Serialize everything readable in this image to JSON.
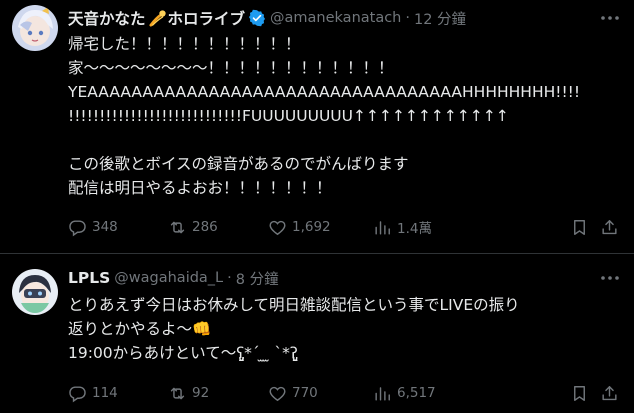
{
  "colors": {
    "background": "#000000",
    "text": "#e7e9ea",
    "muted": "#71767b",
    "verified": "#1d9bf0",
    "divider": "#2f3336"
  },
  "tweets": [
    {
      "display_name": "天音かなた",
      "badge_emoji": "comet-emoji",
      "name_suffix": "ホロライブ",
      "verified": true,
      "handle": "@amanekanatach",
      "separator": "·",
      "time": "12 分鐘",
      "lines": [
        "帰宅した！！！！！！！！！！！",
        "家〜〜〜〜〜〜〜〜！！！！！！！！！！！！",
        "YEAAAAAAAAAAAAAAAAAAAAAAAAAAAAAAAAAAHHHHHHHH!!!!",
        "!!!!!!!!!!!!!!!!!!!!!!!!!!!!FUUUUUUUUU↑↑↑↑↑↑↑↑↑↑↑↑",
        "",
        "この後歌とボイスの録音があるのでがんばります",
        "配信は明日やるよおお！！！！！！！"
      ],
      "stats": {
        "replies": "348",
        "retweets": "286",
        "likes": "1,692",
        "views": "1.4萬"
      }
    },
    {
      "display_name": "LPLS",
      "handle": "@wagahaida_L",
      "separator": "·",
      "time": "8 分鐘",
      "lines": [
        "とりあえず今日はお休みして明日雑談配信という事でLIVEの振り",
        "返りとかやるよ〜👊",
        "19:00からあけといて〜ʕ̡̢̡*ˊ ̫ ̫ ˋ*ʔ̢̡̢"
      ],
      "stats": {
        "replies": "114",
        "retweets": "92",
        "likes": "770",
        "views": "6,517"
      }
    }
  ]
}
